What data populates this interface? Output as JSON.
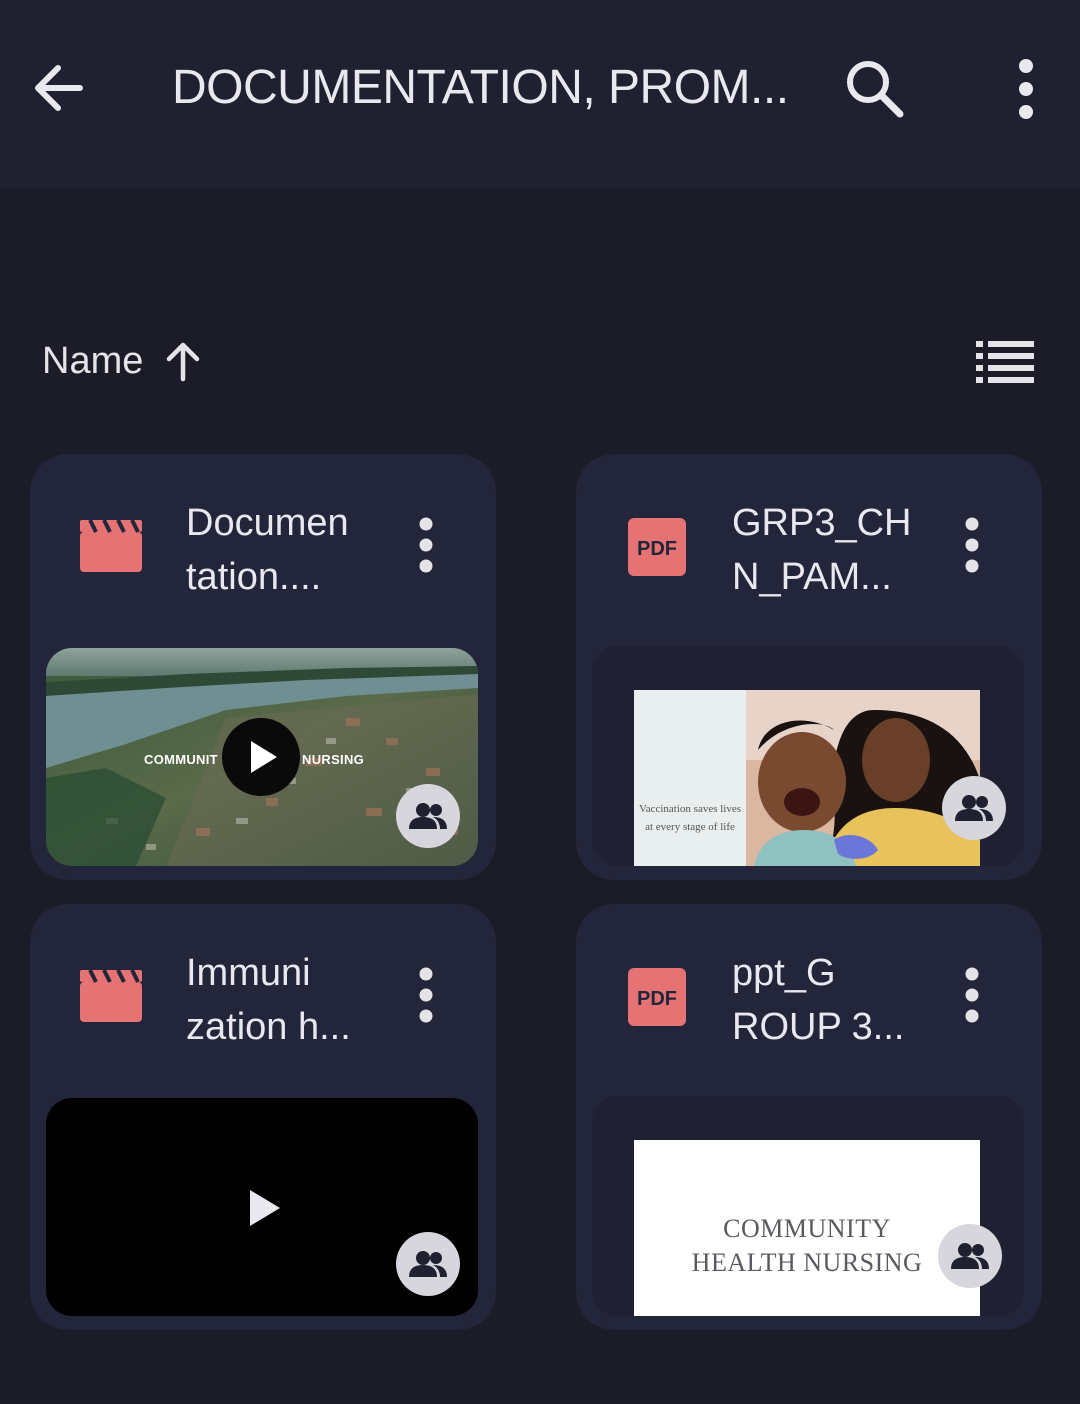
{
  "app_bar": {
    "title": "DOCUMENTATION, PROM...",
    "back_icon": "arrow-left-icon",
    "search_icon": "search-icon",
    "more_icon": "more-vertical-icon"
  },
  "sort": {
    "label": "Name",
    "direction_icon": "arrow-up-icon",
    "view_icon": "list-view-icon"
  },
  "colors": {
    "background": "#1b1c28",
    "app_bar": "#1f2130",
    "card": "#23253a",
    "file_icon_red": "#e57373",
    "text": "#e3e3e8"
  },
  "files": [
    {
      "name_line1": "Documen",
      "name_line2": "tation....",
      "type": "video",
      "type_icon": "video-clapper-icon",
      "thumbnail_text_left": "COMMUNIT",
      "thumbnail_text_right": "NURSING",
      "shared": true
    },
    {
      "name_line1": "GRP3_CH",
      "name_line2": "N_PAM...",
      "type": "pdf",
      "type_label": "PDF",
      "type_icon": "pdf-icon",
      "thumbnail_text": "Vaccination saves lives at every stage of life",
      "shared": true
    },
    {
      "name_line1": "Immuni",
      "name_line2": "zation h...",
      "type": "video",
      "type_icon": "video-clapper-icon",
      "shared": true
    },
    {
      "name_line1": "ppt_G",
      "name_line2": "ROUP 3...",
      "type": "pdf",
      "type_label": "PDF",
      "type_icon": "pdf-icon",
      "thumbnail_text_line1": "COMMUNITY",
      "thumbnail_text_line2": "HEALTH NURSING",
      "shared": true
    }
  ]
}
